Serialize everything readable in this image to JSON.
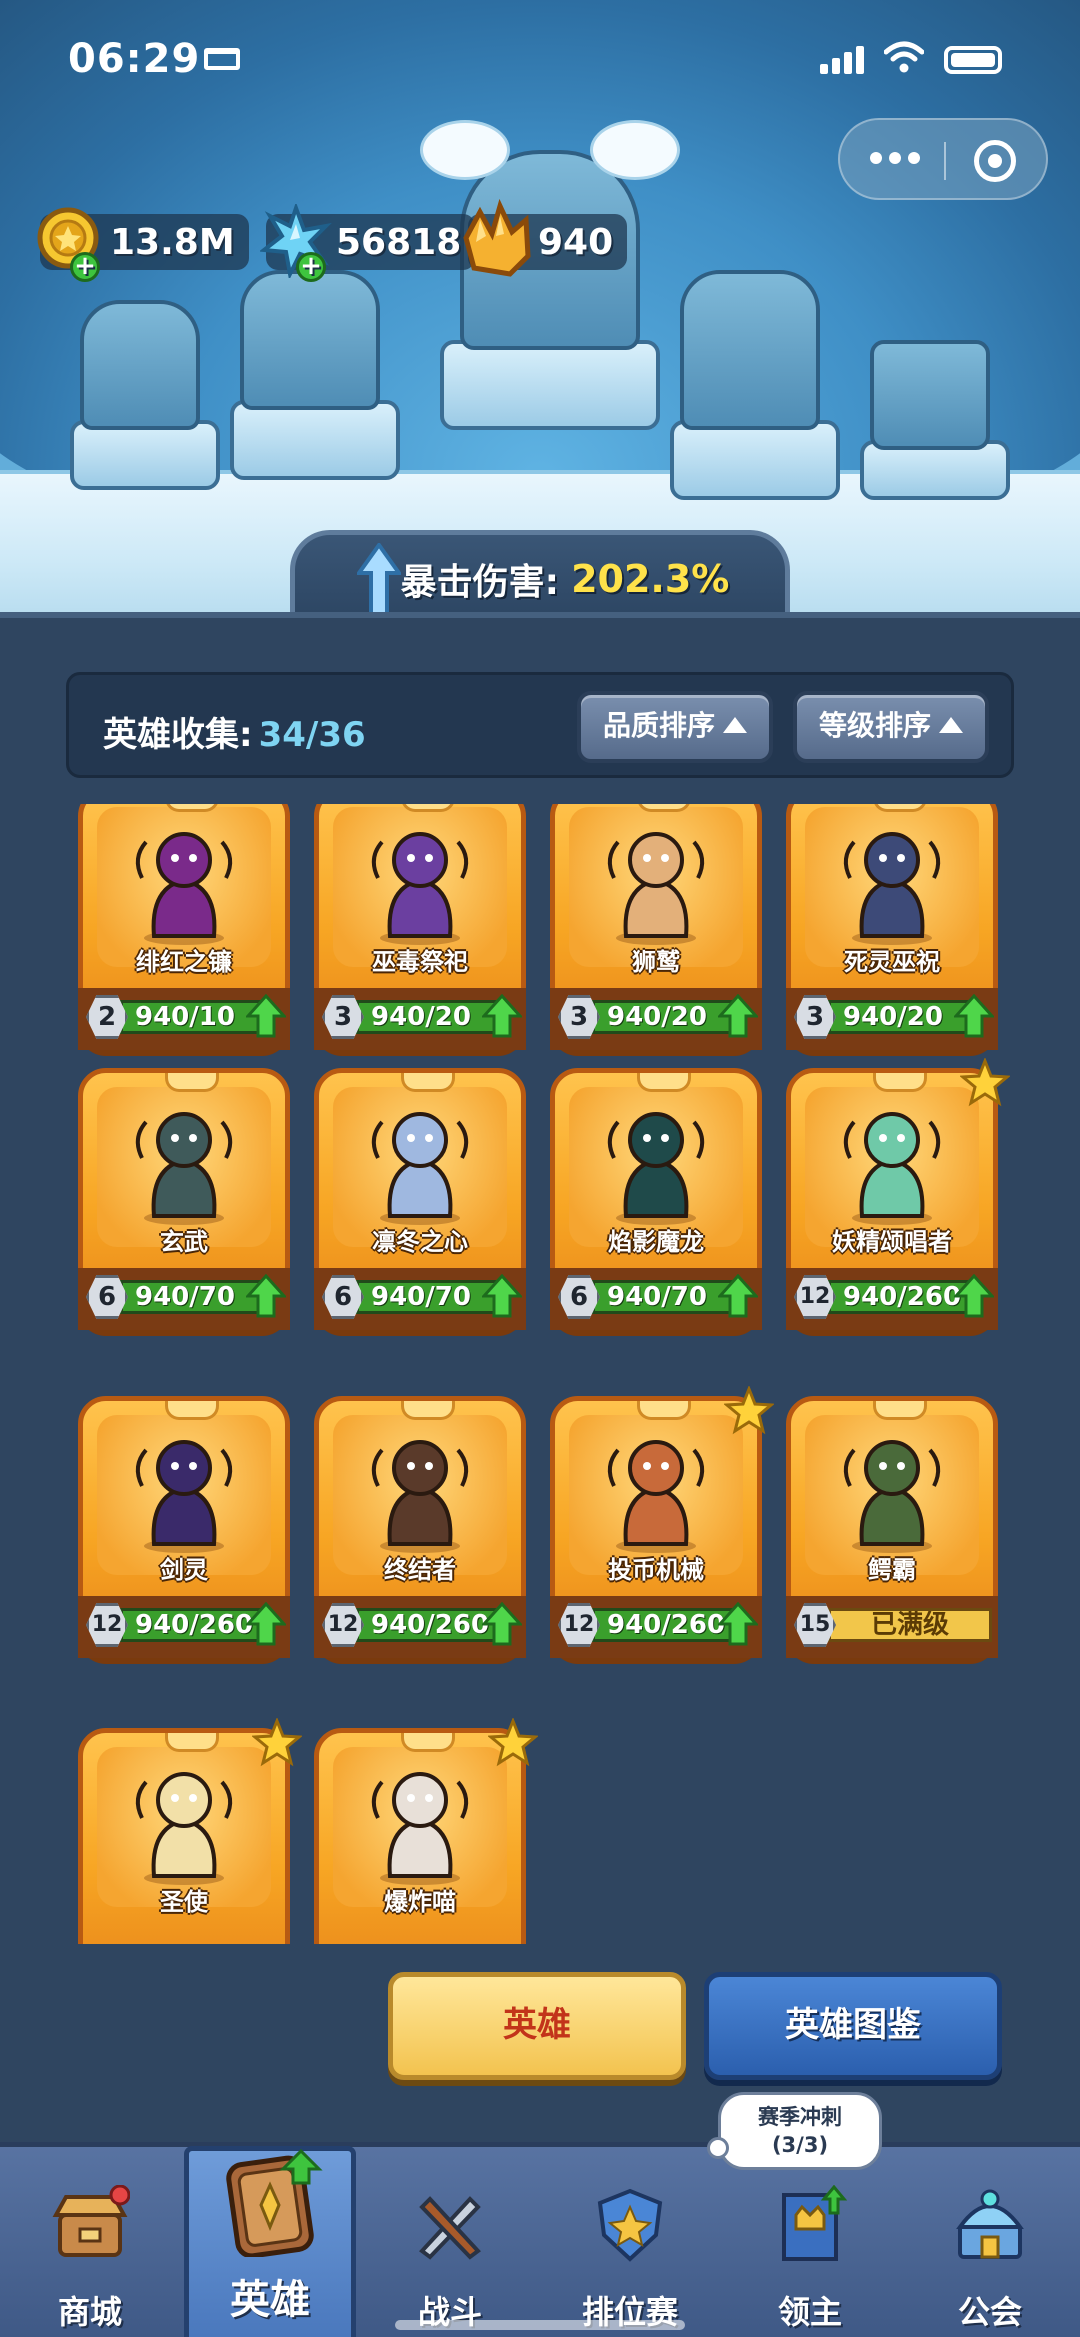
{
  "status_bar": {
    "time": "06:29"
  },
  "currencies": [
    {
      "name": "gold",
      "value": "13.8M",
      "color": "#f4c430"
    },
    {
      "name": "crystal",
      "value": "56818",
      "color": "#5ec8f0"
    },
    {
      "name": "gem",
      "value": "940",
      "color": "#f5a623"
    }
  ],
  "banner": {
    "label": "暴击伤害:",
    "value": "202.3%"
  },
  "collection": {
    "label": "英雄收集:",
    "count": "34/36",
    "sort_quality": "品质排序",
    "sort_level": "等级排序"
  },
  "heroes": [
    {
      "name": "绯红之镰",
      "level": "2",
      "progress": "940/10",
      "starred": false,
      "max": false,
      "color": "#7a2a8a"
    },
    {
      "name": "巫毒祭祀",
      "level": "3",
      "progress": "940/20",
      "starred": false,
      "max": false,
      "color": "#6b3fa0"
    },
    {
      "name": "狮鹫",
      "level": "3",
      "progress": "940/20",
      "starred": false,
      "max": false,
      "color": "#e3b07a"
    },
    {
      "name": "死灵巫祝",
      "level": "3",
      "progress": "940/20",
      "starred": false,
      "max": false,
      "color": "#3d4a78"
    },
    {
      "name": "玄武",
      "level": "6",
      "progress": "940/70",
      "starred": false,
      "max": false,
      "color": "#3f5a5a"
    },
    {
      "name": "凛冬之心",
      "level": "6",
      "progress": "940/70",
      "starred": false,
      "max": false,
      "color": "#9fb8e0"
    },
    {
      "name": "焰影魔龙",
      "level": "6",
      "progress": "940/70",
      "starred": false,
      "max": false,
      "color": "#1f4a4a"
    },
    {
      "name": "妖精颂唱者",
      "level": "12",
      "progress": "940/260",
      "starred": true,
      "max": false,
      "color": "#6fc9a8"
    },
    {
      "name": "剑灵",
      "level": "12",
      "progress": "940/260",
      "starred": false,
      "max": false,
      "color": "#3a2a6a"
    },
    {
      "name": "终结者",
      "level": "12",
      "progress": "940/260",
      "starred": false,
      "max": false,
      "color": "#5a3a2a"
    },
    {
      "name": "投币机械",
      "level": "12",
      "progress": "940/260",
      "starred": true,
      "max": false,
      "color": "#c86a3a"
    },
    {
      "name": "鳄霸",
      "level": "15",
      "progress": "已满级",
      "starred": false,
      "max": true,
      "color": "#4a6a3a"
    },
    {
      "name": "圣使",
      "level": "",
      "progress": "",
      "starred": true,
      "max": false,
      "color": "#f2e0a8"
    },
    {
      "name": "爆炸喵",
      "level": "",
      "progress": "",
      "starred": true,
      "max": false,
      "color": "#e8e0d8"
    }
  ],
  "actions": {
    "heroes_button": "英雄",
    "codex_button": "英雄图鉴"
  },
  "nav": {
    "items": [
      {
        "label": "商城",
        "icon": "shop-icon"
      },
      {
        "label": "英雄",
        "icon": "hero-card-icon"
      },
      {
        "label": "战斗",
        "icon": "battle-icon"
      },
      {
        "label": "排位赛",
        "icon": "ranked-icon"
      },
      {
        "label": "领主",
        "icon": "lord-icon"
      },
      {
        "label": "公会",
        "icon": "guild-icon"
      }
    ],
    "season_bubble_title": "赛季冲刺",
    "season_bubble_count": "(3/3)"
  }
}
